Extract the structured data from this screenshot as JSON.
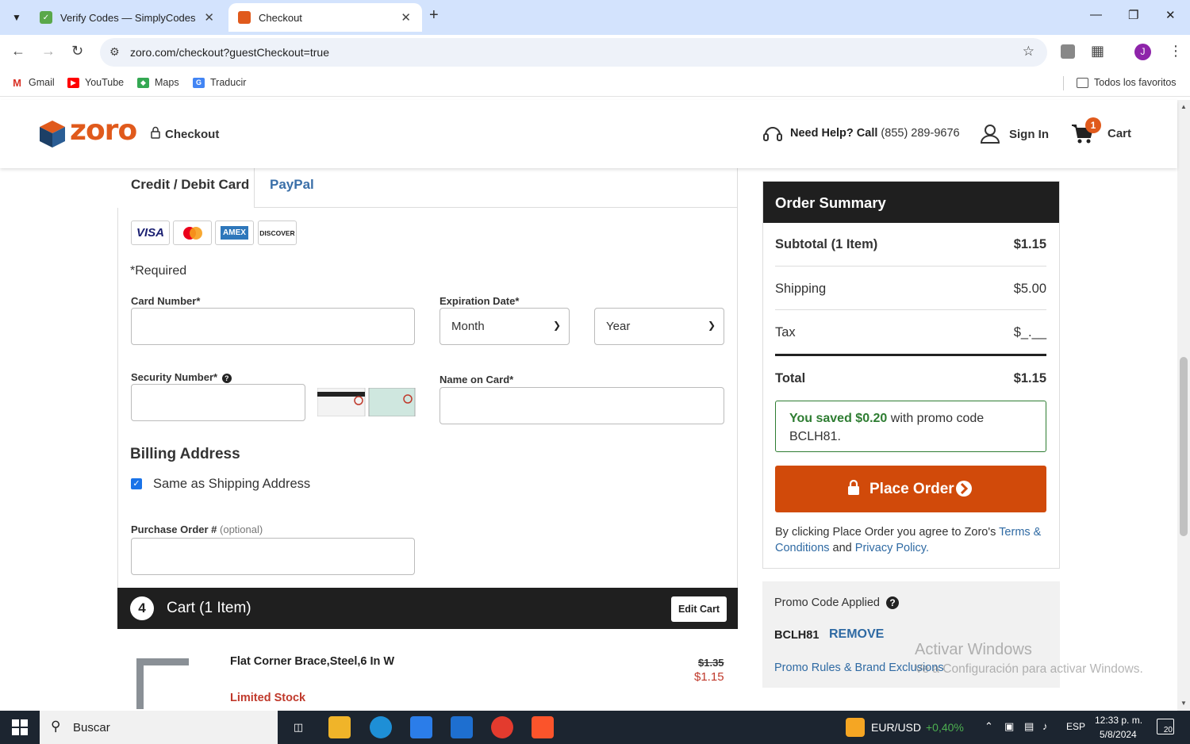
{
  "browser": {
    "tabs": [
      {
        "title": "Verify Codes — SimplyCodes",
        "active": false
      },
      {
        "title": "Checkout",
        "active": true
      }
    ],
    "url": "zoro.com/checkout?guestCheckout=true",
    "profile_initial": "J",
    "bookmarks": [
      "Gmail",
      "YouTube",
      "Maps",
      "Traducir"
    ],
    "all_bookmarks": "Todos los favoritos"
  },
  "header": {
    "logo": "zoro",
    "checkout_label": "Checkout",
    "help_bold": "Need Help? Call",
    "help_phone": "(855) 289-9676",
    "sign_in": "Sign In",
    "cart_label": "Cart",
    "cart_count": "1"
  },
  "payment": {
    "tab_card": "Credit / Debit Card",
    "tab_paypal": "PayPal",
    "card_brands": [
      "VISA",
      "mastercard",
      "AMEX",
      "DISCOVER"
    ],
    "required_note": "*Required",
    "card_number_label": "Card Number*",
    "expiration_label": "Expiration Date*",
    "month_value": "Month",
    "year_value": "Year",
    "security_label": "Security Number*",
    "name_label": "Name on Card*",
    "billing_title": "Billing Address",
    "same_as_shipping": "Same as Shipping Address",
    "po_label": "Purchase Order #",
    "po_optional": "(optional)"
  },
  "cart": {
    "step": "4",
    "title": "Cart (1 Item)",
    "edit_label": "Edit Cart",
    "item_name": "Flat Corner Brace,Steel,6 In W",
    "item_stock": "Limited Stock",
    "item_old_price": "$1.35",
    "item_price": "$1.15"
  },
  "summary": {
    "title": "Order Summary",
    "subtotal_label": "Subtotal (1 Item)",
    "subtotal": "$1.15",
    "shipping_label": "Shipping",
    "shipping": "$5.00",
    "tax_label": "Tax",
    "tax": "$_.__",
    "total_label": "Total",
    "total": "$1.15",
    "saved_prefix": "You saved $0.20",
    "saved_suffix": "with promo code BCLH81.",
    "place_order": "Place Order",
    "terms_prefix": "By clicking Place Order you agree to Zoro's",
    "terms_link": "Terms & Conditions",
    "terms_and": "and",
    "privacy_link": "Privacy Policy."
  },
  "promo": {
    "title": "Promo Code Applied",
    "code": "BCLH81",
    "remove": "REMOVE",
    "rules": "Promo Rules & Brand Exclusions"
  },
  "watermark": {
    "line1": "Activar Windows",
    "line2": "Ve a Configuración para activar Windows."
  },
  "taskbar": {
    "search": "Buscar",
    "fx_label": "EUR/USD",
    "fx_change": "+0,40%",
    "lang": "ESP",
    "time": "12:33 p. m.",
    "date": "5/8/2024",
    "notifications": "20"
  },
  "colors": {
    "brand_orange": "#e05a1c",
    "place_order": "#d14a0a",
    "link_blue": "#2f6aa3",
    "saved_green": "#2e7d32",
    "stock_red": "#c0392b"
  }
}
